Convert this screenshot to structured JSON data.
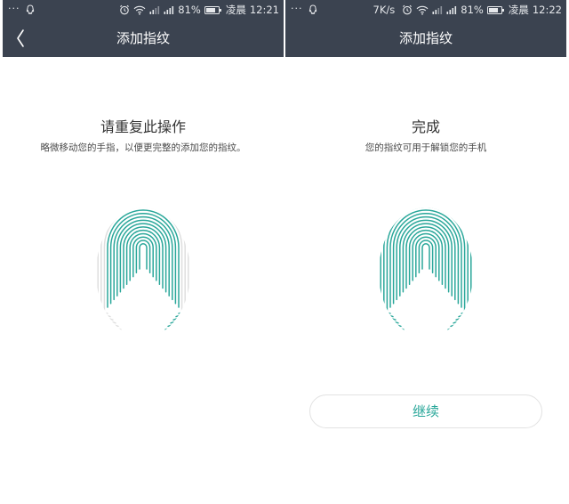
{
  "colors": {
    "bar_bg": "#3b4350",
    "accent": "#2aa79a",
    "ridge_inactive": "#dedede"
  },
  "left_screen": {
    "status": {
      "dots": "···",
      "battery": "81%",
      "battery_level": 0.81,
      "period": "凌晨",
      "time": "12:21"
    },
    "title": "添加指纹",
    "heading": "请重复此操作",
    "subtext": "略微移动您的手指，以便更完整的添加您的指纹。",
    "fingerprint_progress": 0.7
  },
  "right_screen": {
    "status": {
      "dots": "···",
      "speed": "7K/s",
      "battery": "81%",
      "battery_level": 0.81,
      "period": "凌晨",
      "time": "12:22"
    },
    "title": "添加指纹",
    "heading": "完成",
    "subtext": "您的指纹可用于解锁您的手机",
    "fingerprint_progress": 1,
    "continue_label": "继续"
  }
}
